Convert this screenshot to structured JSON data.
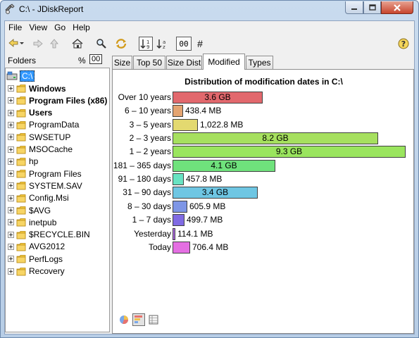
{
  "window": {
    "title": "C:\\ - JDiskReport"
  },
  "menu": {
    "file": "File",
    "view": "View",
    "go": "Go",
    "help": "Help"
  },
  "toolbar": {
    "size_toggle": "00",
    "hash": "#"
  },
  "folders": {
    "header": "Folders",
    "pct_label": "%",
    "size_label": "00",
    "root": "C:\\",
    "items": [
      {
        "label": "Windows",
        "bold": true
      },
      {
        "label": "Program Files (x86)",
        "bold": true
      },
      {
        "label": "Users",
        "bold": true
      },
      {
        "label": "ProgramData",
        "bold": false
      },
      {
        "label": "SWSETUP",
        "bold": false
      },
      {
        "label": "MSOCache",
        "bold": false
      },
      {
        "label": "hp",
        "bold": false
      },
      {
        "label": "Program Files",
        "bold": false
      },
      {
        "label": "SYSTEM.SAV",
        "bold": false
      },
      {
        "label": "Config.Msi",
        "bold": false
      },
      {
        "label": "$AVG",
        "bold": false
      },
      {
        "label": "inetpub",
        "bold": false
      },
      {
        "label": "$RECYCLE.BIN",
        "bold": false
      },
      {
        "label": "AVG2012",
        "bold": false
      },
      {
        "label": "PerfLogs",
        "bold": false
      },
      {
        "label": "Recovery",
        "bold": false
      }
    ]
  },
  "tabs": {
    "size": "Size",
    "top50": "Top 50",
    "sizedist": "Size Dist",
    "modified": "Modified",
    "types": "Types",
    "active": "Modified"
  },
  "chart_data": {
    "type": "bar",
    "orientation": "horizontal",
    "title": "Distribution of modification dates in C:\\",
    "unit": "MB",
    "categories": [
      "Over 10 years",
      "6 – 10 years",
      "3 – 5 years",
      "2 – 3 years",
      "1 – 2 years",
      "181 – 365 days",
      "91 – 180 days",
      "31 – 90 days",
      "8 – 30 days",
      "1 – 7 days",
      "Yesterday",
      "Today"
    ],
    "values": [
      3686.4,
      438.4,
      1022.8,
      8396.8,
      9523.2,
      4198.4,
      457.8,
      3481.6,
      605.9,
      499.7,
      114.1,
      706.4
    ],
    "value_labels": [
      "3.6 GB",
      "438.4 MB",
      "1,022.8 MB",
      "8.2 GB",
      "9.3 GB",
      "4.1 GB",
      "457.8 MB",
      "3.4 GB",
      "605.9 MB",
      "499.7 MB",
      "114.1 MB",
      "706.4 MB"
    ],
    "colors": [
      "#e2686d",
      "#e4a471",
      "#e3d970",
      "#a6e05f",
      "#9ae55e",
      "#6fe27c",
      "#68e3c2",
      "#6ec6e3",
      "#7e96e6",
      "#806be3",
      "#ad6ae1",
      "#e46fe2"
    ],
    "xlim": [
      0,
      9523.2
    ],
    "grid": false,
    "legend": "none"
  }
}
